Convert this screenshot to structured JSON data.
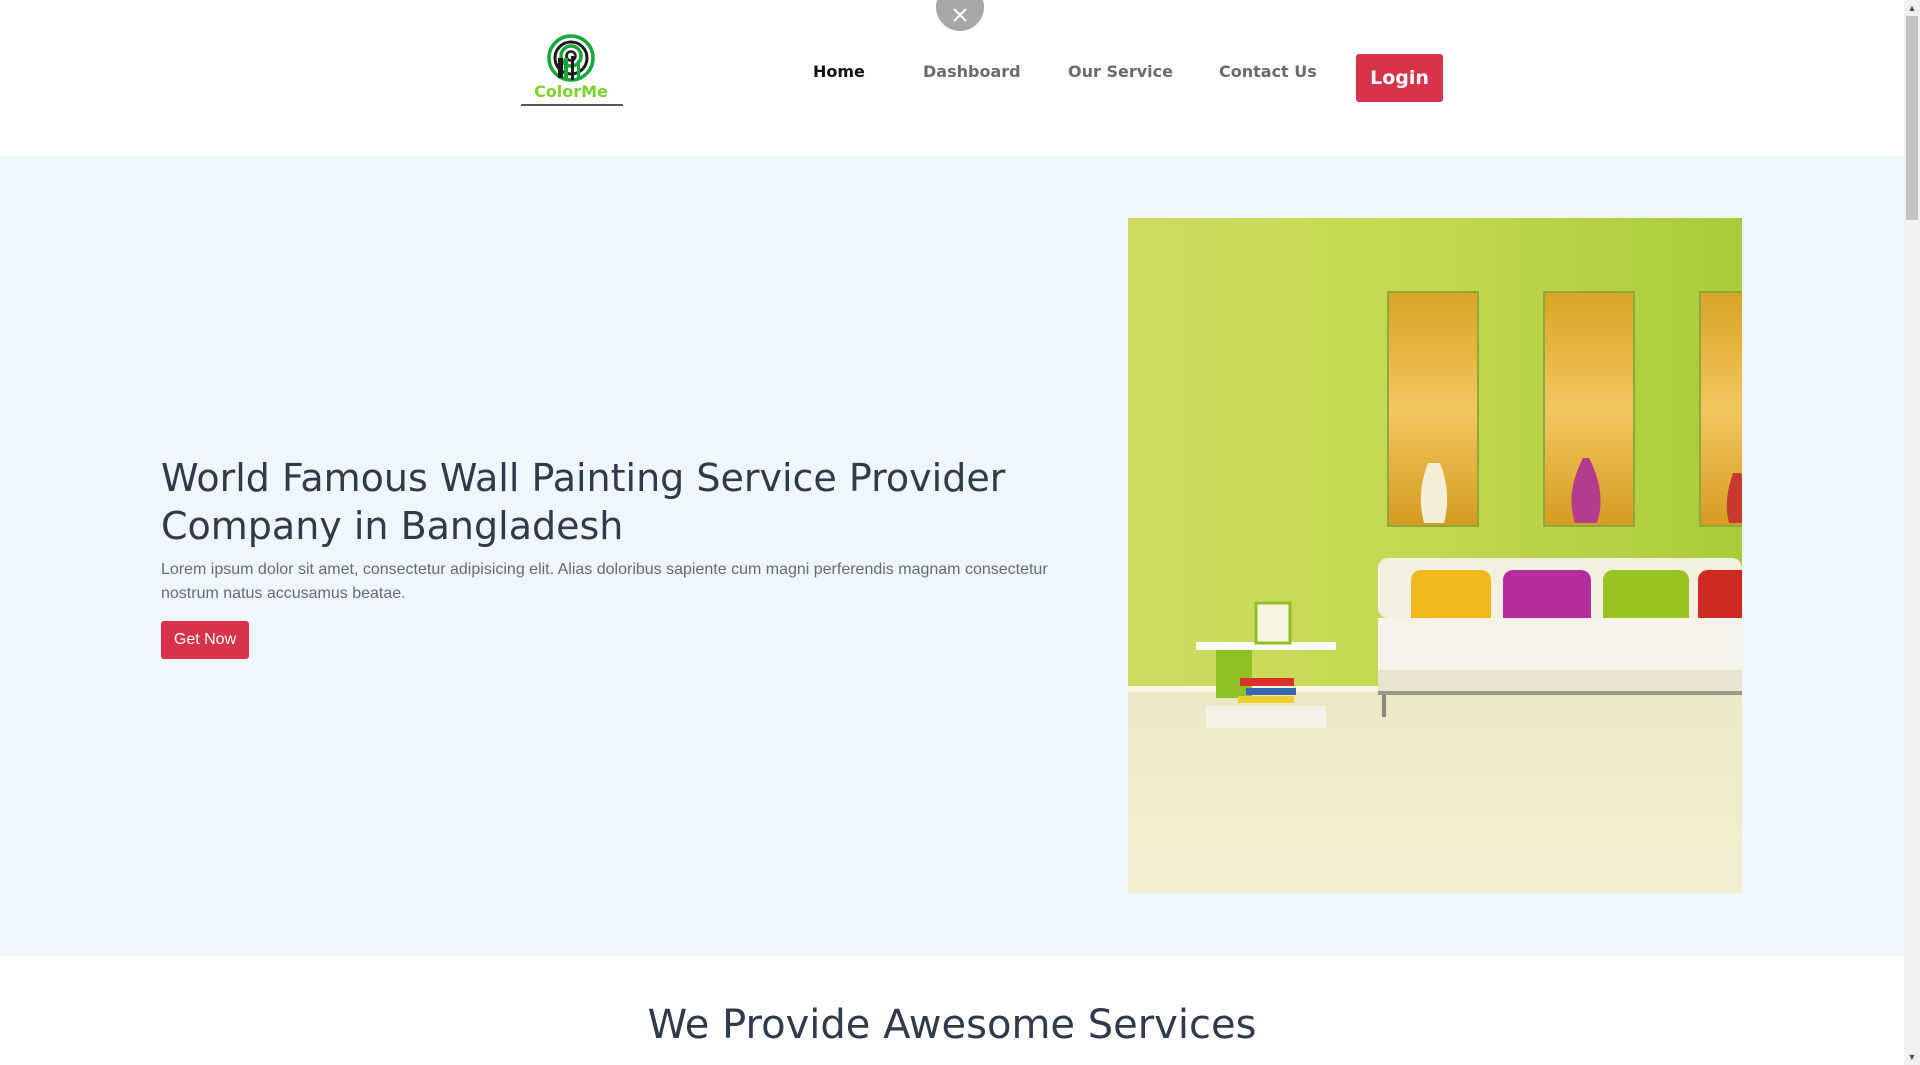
{
  "header": {
    "logo_text": "ColorMe",
    "nav": [
      {
        "label": "Home",
        "active": true
      },
      {
        "label": "Dashboard",
        "active": false
      },
      {
        "label": "Our Service",
        "active": false
      },
      {
        "label": "Contact Us",
        "active": false
      }
    ],
    "login_label": "Login",
    "close_icon": "close-icon"
  },
  "hero": {
    "title": "World Famous Wall Painting Service Provider Company in Bangladesh",
    "description": "Lorem ipsum dolor sit amet, consectetur adipisicing elit. Alias doloribus sapiente cum magni perferendis magnam consectetur nostrum natus accusamus beatae.",
    "button_label": "Get Now",
    "image_subject": "living-room-with-green-wall-and-white-sofa"
  },
  "services": {
    "title": "We Provide Awesome Services"
  },
  "colors": {
    "accent": "#d7334a",
    "hero_bg": "#eff7fd",
    "logo_green": "#7bd42a",
    "heading": "#2f3a4b"
  }
}
